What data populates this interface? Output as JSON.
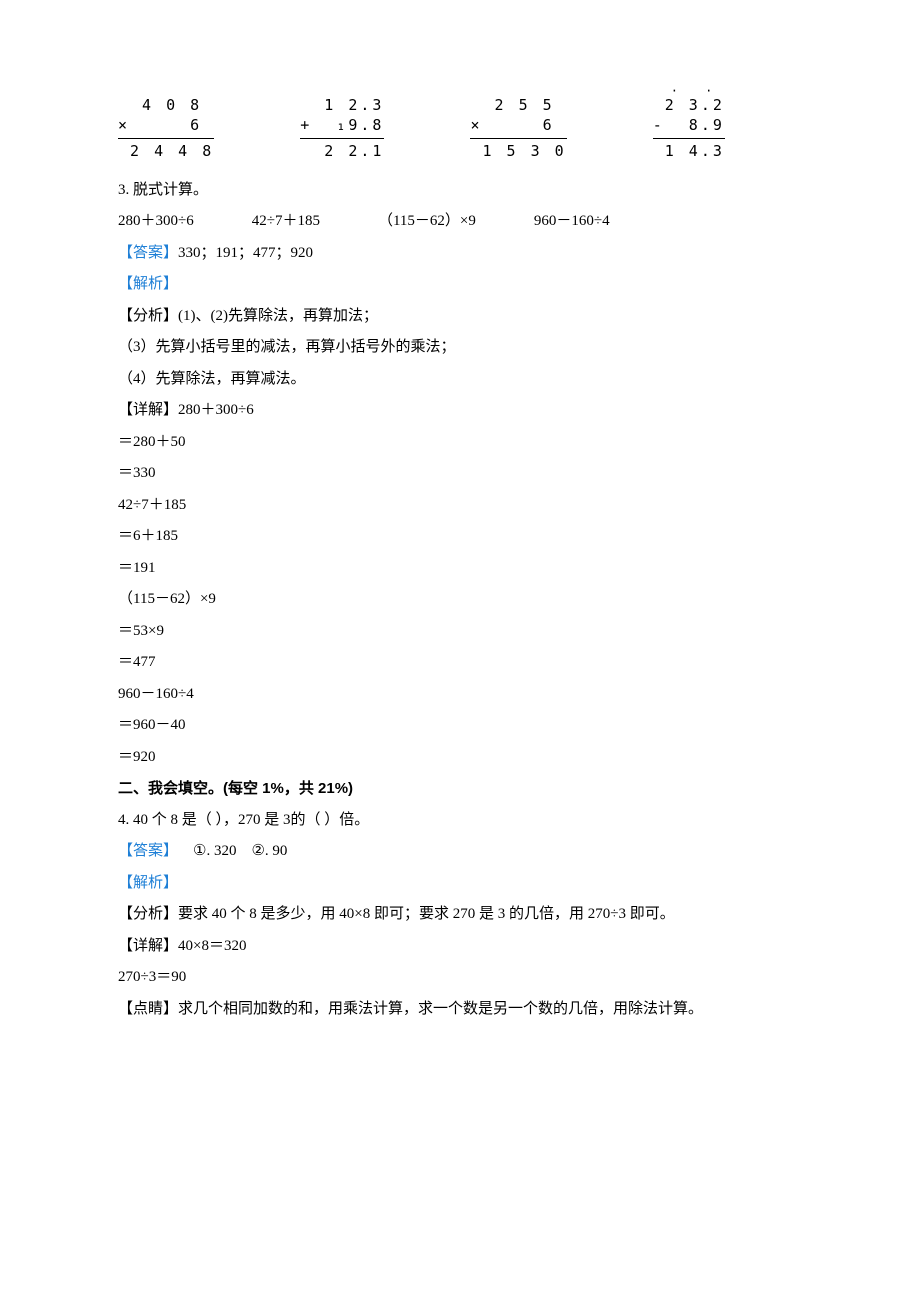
{
  "vert": {
    "c1": {
      "r1": "  4 0 8",
      "r2": "×     6",
      "r3": " 2 4 4 8"
    },
    "c2": {
      "r1": "  1 2.3",
      "r2": "+  ₁9.8",
      "r3": "  2 2.1"
    },
    "c3": {
      "r1": "  2 5 5",
      "r2": "×     6",
      "r3": " 1 5 3 0"
    },
    "c4": {
      "r1": " 2 3.2",
      "r2": "-  8.9",
      "r3": " 1 4.3"
    }
  },
  "q3": {
    "title": "3. 脱式计算。",
    "p1": "280＋300÷6",
    "p2": "42÷7＋185",
    "p3": "（115－62）×9",
    "p4": "960－160÷4",
    "ans_label": "【答案】",
    "ans": "330；191；477；920",
    "jiexi": "【解析】",
    "fenxi12": "【分析】(1)、(2)先算除法，再算加法；",
    "fenxi3": "（3）先算小括号里的减法，再算小括号外的乘法；",
    "fenxi4": "（4）先算除法，再算减法。",
    "xj_label": "【详解】",
    "xj_head": "280＋300÷6",
    "s1a": "＝280＋50",
    "s1b": "＝330",
    "s2h": "42÷7＋185",
    "s2a": "＝6＋185",
    "s2b": "＝191",
    "s3h": "（115－62）×9",
    "s3a": "＝53×9",
    "s3b": "＝477",
    "s4h": "960－160÷4",
    "s4a": "＝960－40",
    "s4b": "＝920"
  },
  "sec2": "二、我会填空。(每空 1%，共 21%)",
  "q4": {
    "title": "4. 40 个 8 是（      ），270 是 3的（      ）倍。",
    "ans_label": "【答案】",
    "ans": "    ①. 320    ②. 90",
    "jiexi": "【解析】",
    "fenxi": "【分析】要求 40 个 8 是多少，用 40×8 即可；要求 270 是 3 的几倍，用 270÷3 即可。",
    "xj_label": "【详解】",
    "xj1": "40×8＝320",
    "xj2": "270÷3＝90",
    "dj": "【点睛】求几个相同加数的和，用乘法计算，求一个数是另一个数的几倍，用除法计算。"
  }
}
